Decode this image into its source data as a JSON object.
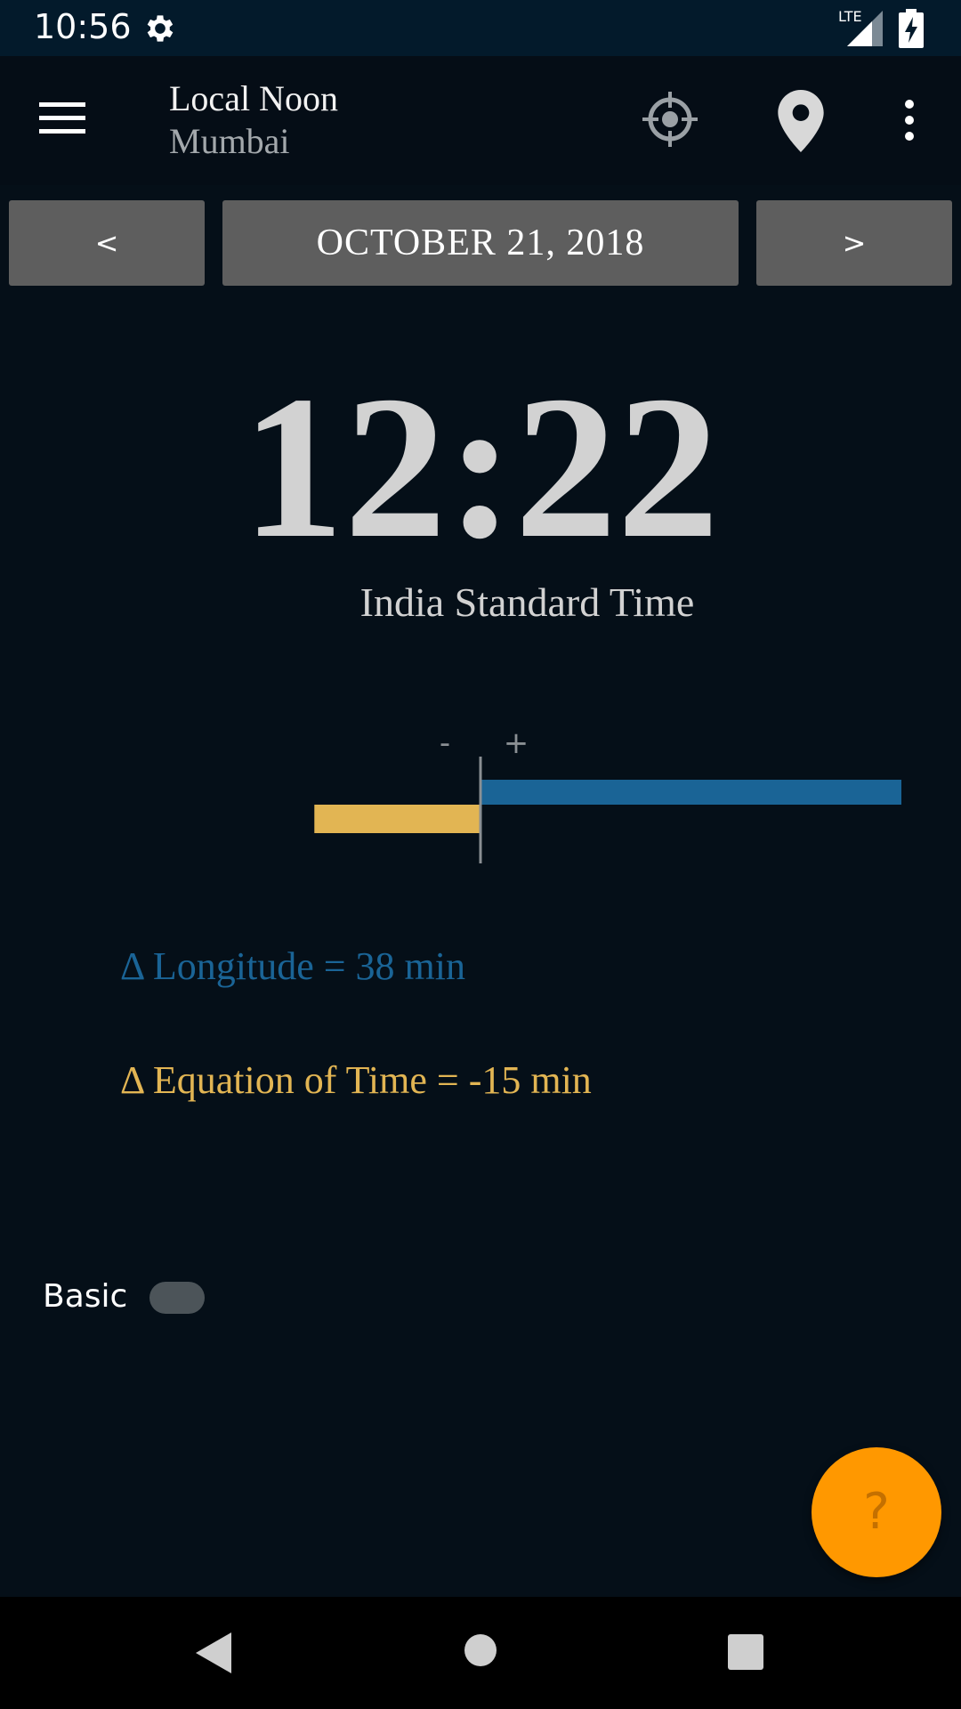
{
  "status_bar": {
    "time": "10:56",
    "network": "LTE"
  },
  "app_bar": {
    "title": "Local Noon",
    "subtitle": "Mumbai"
  },
  "date_nav": {
    "prev_label": "<",
    "date": "OCTOBER 21, 2018",
    "next_label": ">"
  },
  "noon": {
    "time": "12:22",
    "timezone": "India Standard Time"
  },
  "chart_data": {
    "type": "bar",
    "orientation": "horizontal",
    "axis_labels": {
      "negative": "-",
      "positive": "+"
    },
    "series": [
      {
        "name": "Longitude",
        "value": 38,
        "unit": "min",
        "color": "#1a6496"
      },
      {
        "name": "Equation of Time",
        "value": -15,
        "unit": "min",
        "color": "#e2b553"
      }
    ]
  },
  "deltas": {
    "longitude": "Δ Longitude = 38 min",
    "equation_of_time": "Δ Equation of Time = -15 min"
  },
  "colors": {
    "longitude": "#1a6496",
    "equation_of_time": "#e2b553",
    "fab": "#ff9800"
  },
  "basic_toggle": {
    "label": "Basic",
    "on": false
  },
  "help_fab": {
    "label": "?"
  }
}
